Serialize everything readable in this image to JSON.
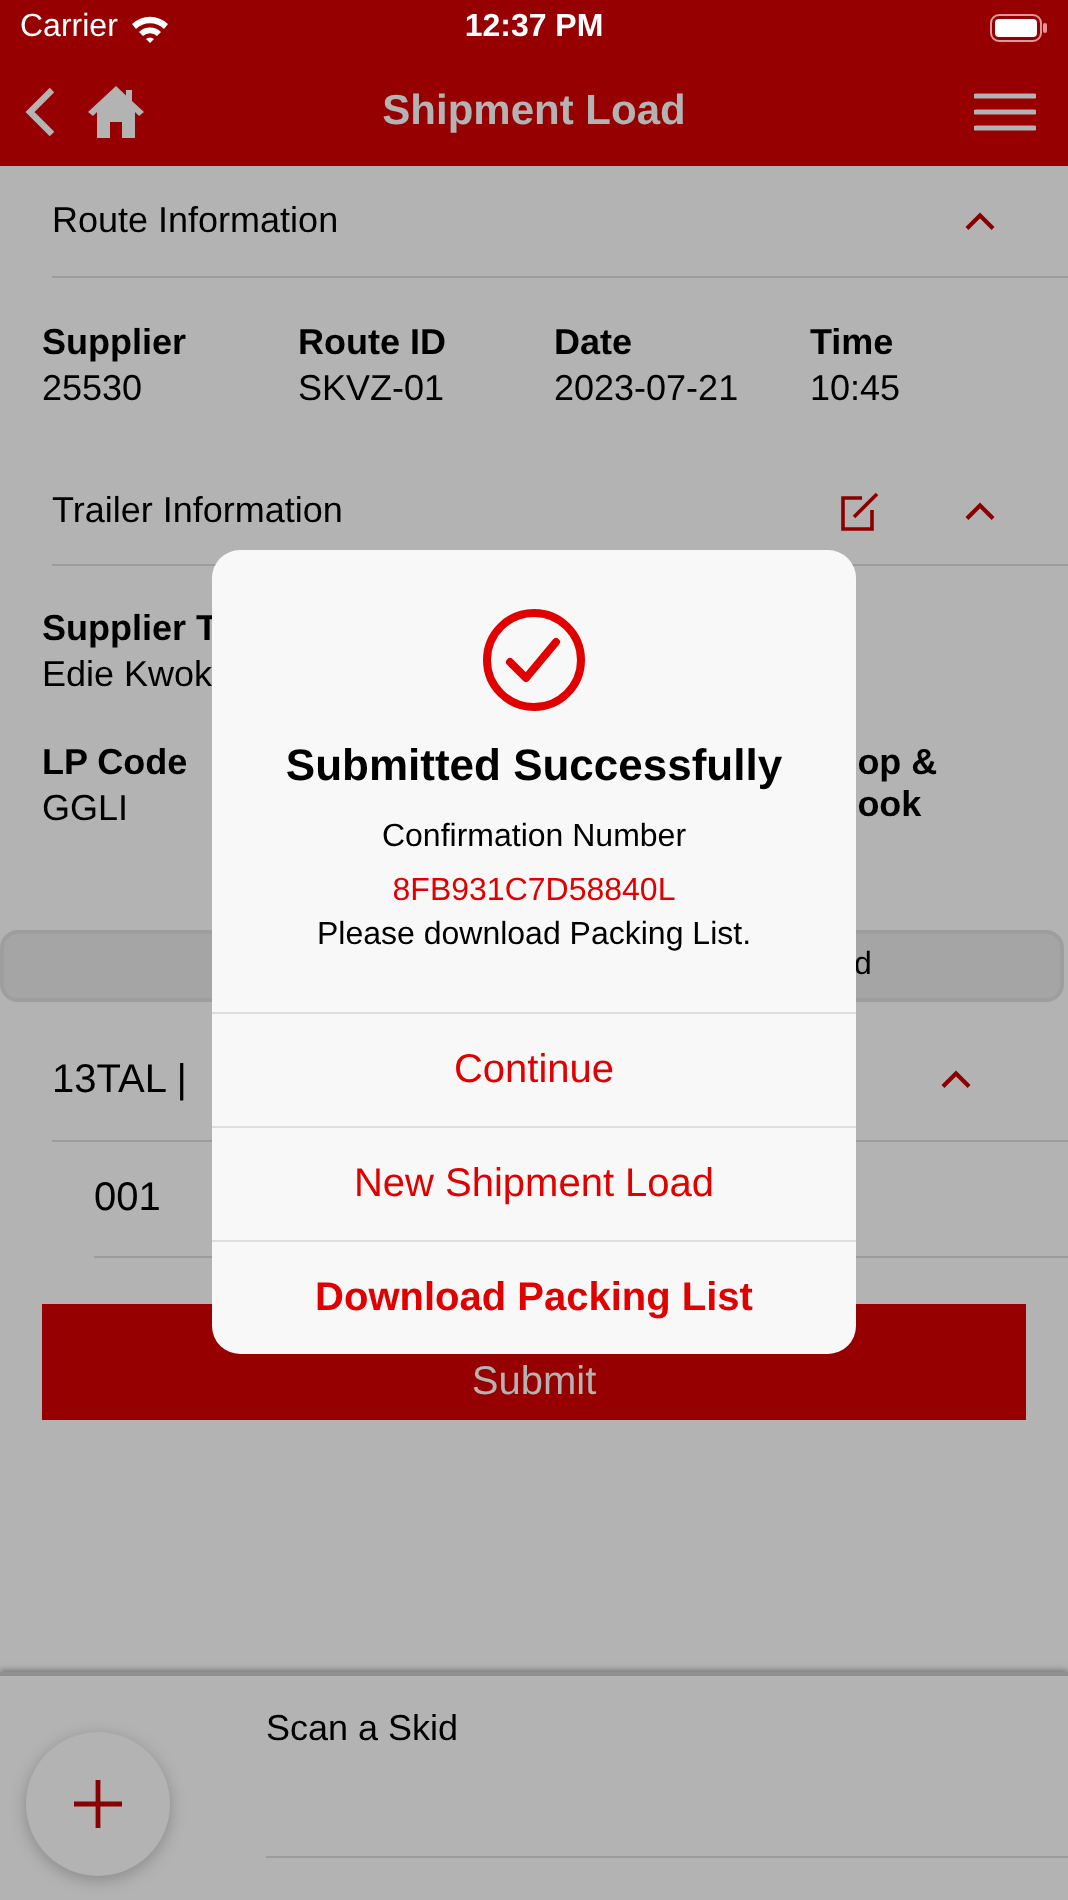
{
  "status_bar": {
    "carrier": "Carrier",
    "time": "12:37 PM"
  },
  "nav": {
    "title": "Shipment Load"
  },
  "route_section": {
    "title": "Route Information",
    "expanded": true,
    "fields": [
      {
        "label": "Supplier",
        "value": "25530"
      },
      {
        "label": "Route ID",
        "value": "SKVZ-01"
      },
      {
        "label": "Date",
        "value": "2023-07-21"
      },
      {
        "label": "Time",
        "value": "10:45"
      }
    ]
  },
  "trailer_section": {
    "title": "Trailer Information",
    "expanded": true,
    "fields": [
      {
        "label": "Supplier T",
        "value": "Edie Kwok"
      },
      {
        "label": "LP Code",
        "value": "GGLI"
      },
      {
        "label": "op &\nook"
      }
    ]
  },
  "segment_control": {
    "right_label": "d"
  },
  "skid_section": {
    "title": "13TAL |",
    "expanded": true,
    "items": [
      "001"
    ]
  },
  "submit_button": {
    "label": "Submit"
  },
  "bottom_sheet": {
    "scan_label": "Scan a Skid"
  },
  "dialog": {
    "title": "Submitted Successfully",
    "subtitle": "Confirmation Number",
    "confirmation_number": "8FB931C7D58840L",
    "message": "Please download Packing List.",
    "actions": [
      {
        "label": "Continue",
        "primary": false
      },
      {
        "label": "New Shipment Load",
        "primary": false
      },
      {
        "label": "Download Packing List",
        "primary": true
      }
    ]
  }
}
